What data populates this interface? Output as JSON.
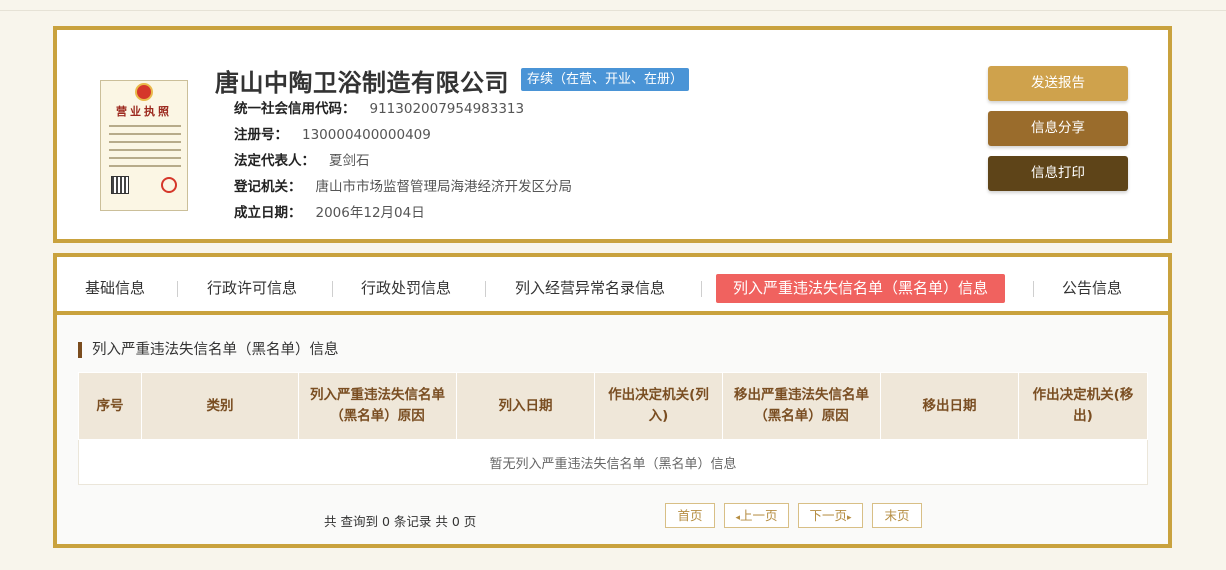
{
  "company": {
    "name": "唐山中陶卫浴制造有限公司",
    "status": "存续（在营、开业、在册）",
    "license_title": "营业执照",
    "fields": [
      {
        "label": "统一社会信用代码：",
        "value": "911302007954983313"
      },
      {
        "label": "注册号：",
        "value": "130000400000409"
      },
      {
        "label": "法定代表人：",
        "value": "夏剑石"
      },
      {
        "label": "登记机关：",
        "value": "唐山市市场监督管理局海港经济开发区分局"
      },
      {
        "label": "成立日期：",
        "value": "2006年12月04日"
      }
    ]
  },
  "actions": {
    "send_report": "发送报告",
    "share": "信息分享",
    "print": "信息打印"
  },
  "tabs": [
    {
      "label": "基础信息",
      "active": false
    },
    {
      "label": "行政许可信息",
      "active": false
    },
    {
      "label": "行政处罚信息",
      "active": false
    },
    {
      "label": "列入经营异常名录信息",
      "active": false
    },
    {
      "label": "列入严重违法失信名单（黑名单）信息",
      "active": true
    },
    {
      "label": "公告信息",
      "active": false
    }
  ],
  "section": {
    "title": "列入严重违法失信名单（黑名单）信息",
    "columns": [
      "序号",
      "类别",
      "列入严重违法失信名单（黑名单）原因",
      "列入日期",
      "作出决定机关(列入)",
      "移出严重违法失信名单（黑名单）原因",
      "移出日期",
      "作出决定机关(移出)"
    ],
    "empty_text": "暂无列入严重违法失信名单（黑名单）信息"
  },
  "pagination": {
    "summary": "共 查询到 0 条记录 共 0 页",
    "first": "首页",
    "prev": "上一页",
    "next": "下一页",
    "last": "末页"
  },
  "colors": {
    "border_gold": "#c9a23e",
    "active_tab": "#f0625f",
    "status_badge": "#4a94d6"
  }
}
